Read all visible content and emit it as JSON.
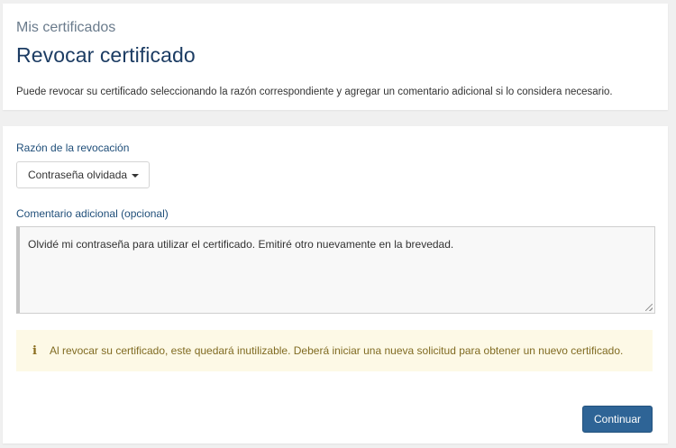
{
  "header": {
    "breadcrumb": "Mis certificados",
    "title": "Revocar certificado",
    "description": "Puede revocar su certificado seleccionando la razón correspondiente y agregar un comentario adicional si lo considera necesario."
  },
  "form": {
    "reason_label": "Razón de la revocación",
    "reason_selected": "Contraseña olvidada",
    "comment_label": "Comentario adicional (opcional)",
    "comment_value": "Olvidé mi contraseña para utilizar el certificado. Emitiré otro nuevamente en la brevedad.",
    "alert_icon": "info-icon",
    "alert_text": "Al revocar su certificado, este quedará inutilizable. Deberá iniciar una nueva solicitud para obtener un nuevo certificado.",
    "continue_label": "Continuar"
  },
  "colors": {
    "title": "#1c3c63",
    "label": "#1f4e79",
    "alert_bg": "#fdf9e6",
    "alert_text": "#806b22",
    "primary_button": "#2e6496"
  }
}
